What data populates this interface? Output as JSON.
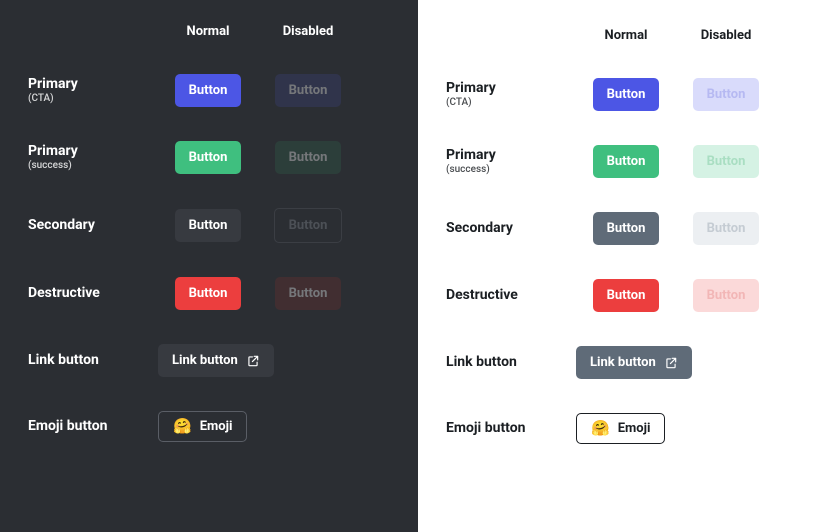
{
  "columns": {
    "normal": "Normal",
    "disabled": "Disabled"
  },
  "rows": {
    "primary_cta": {
      "label": "Primary",
      "note": "(CTA)"
    },
    "primary_success": {
      "label": "Primary",
      "note": "(success)"
    },
    "secondary": {
      "label": "Secondary",
      "note": ""
    },
    "destructive": {
      "label": "Destructive",
      "note": ""
    },
    "link": {
      "label": "Link button",
      "note": ""
    },
    "emoji": {
      "label": "Emoji button",
      "note": ""
    }
  },
  "button_text": "Button",
  "link_button_text": "Link button",
  "emoji_button_text": "Emoji",
  "emoji_glyph": "🤗",
  "colors": {
    "cta": "#4C56E5",
    "success": "#3FBF7F",
    "secondary_dark": "#373A40",
    "secondary_light": "#5f6b78",
    "destructive": "#EC3E3E",
    "dark_bg": "#2B2E33",
    "light_bg": "#FFFFFF"
  }
}
